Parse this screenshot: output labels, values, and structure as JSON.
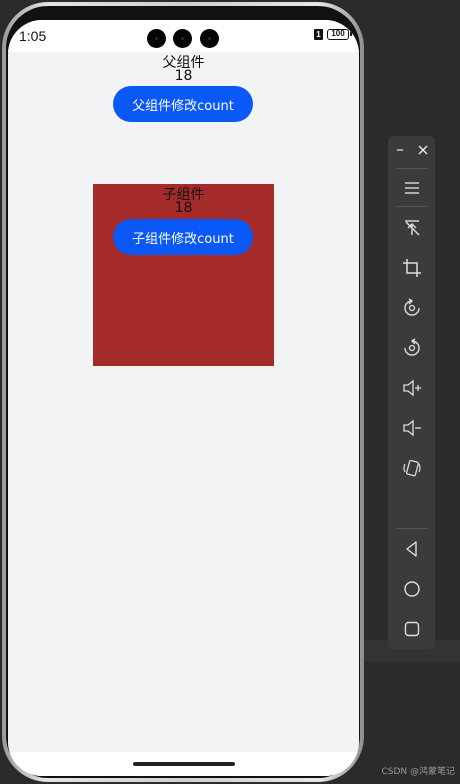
{
  "status_bar": {
    "time": "1:05",
    "sim_label": "1",
    "battery": "100"
  },
  "parent": {
    "title": "父组件",
    "count": "18",
    "button_label": "父组件修改count"
  },
  "child": {
    "title": "子组件",
    "count": "18",
    "button_label": "子组件修改count"
  },
  "colors": {
    "accent": "#0a59f7",
    "child_bg": "#a52a2a",
    "screen_bg": "#f1f3f5"
  },
  "toolbar": {
    "icons": [
      "minimize-icon",
      "close-icon",
      "menu-icon",
      "pin-top-icon",
      "crop-icon",
      "rotate-left-icon",
      "rotate-right-icon",
      "volume-up-icon",
      "volume-down-icon",
      "shake-icon",
      "back-icon",
      "home-icon",
      "recent-icon"
    ]
  },
  "watermark": "CSDN @鸿蒙笔记"
}
